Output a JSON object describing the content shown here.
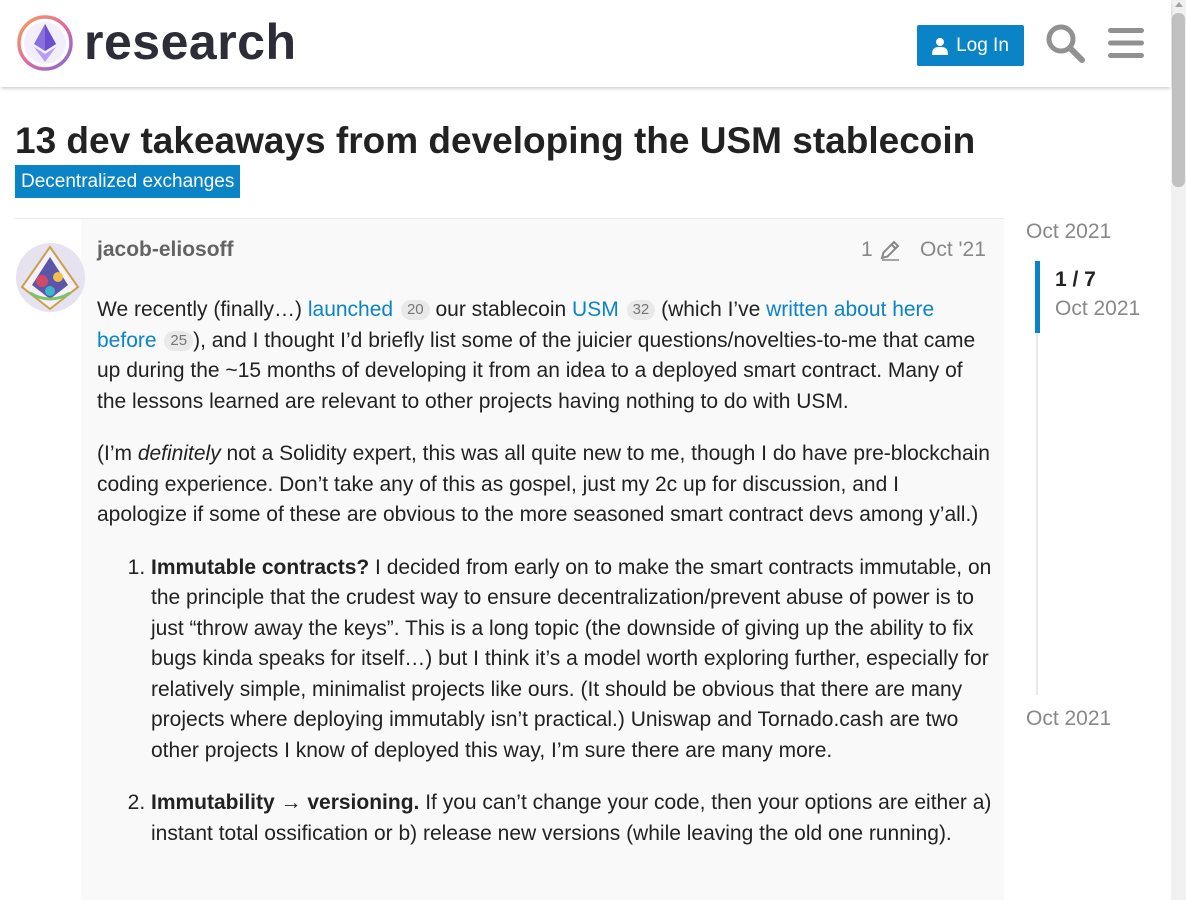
{
  "header": {
    "site_name": "research",
    "login_label": "Log In",
    "brand_color": "#0a84c7"
  },
  "topic": {
    "title": "13 dev takeaways from developing the USM stablecoin",
    "category": "Decentralized exchanges"
  },
  "post": {
    "username": "jacob-eliosoff",
    "edit_count": "1",
    "date": "Oct '21",
    "p1": {
      "t1": "We recently (finally…) ",
      "link1": "launched",
      "clicks1": "20",
      "t2": " our stablecoin ",
      "link2": "USM",
      "clicks2": "32",
      "t3": " (which I’ve ",
      "link3": "written about here before",
      "clicks3": "25",
      "t4": "), and I thought I’d briefly list some of the juicier questions/novelties-to-me that came up during the ~15 months of developing it from an idea to a deployed smart contract. Many of the lessons learned are relevant to other projects having nothing to do with USM."
    },
    "p2": {
      "t1": "(I’m ",
      "em": "definitely",
      "t2": " not a Solidity expert, this was all quite new to me, though I do have pre-blockchain coding experience. Don’t take any of this as gospel, just my 2c up for discussion, and I apologize if some of these are obvious to the more seasoned smart contract devs among y’all.)"
    },
    "list": [
      {
        "heading": "Immutable contracts?",
        "text": " I decided from early on to make the smart contracts immutable, on the principle that the crudest way to ensure decentralization/prevent abuse of power is to just “throw away the keys”. This is a long topic (the downside of giving up the ability to fix bugs kinda speaks for itself…) but I think it’s a model worth exploring further, especially for relatively simple, minimalist projects like ours. (It should be obvious that there are many projects where deploying immutably isn’t practical.) Uniswap and Tornado.cash are two other projects I know of deployed this way, I’m sure there are many more."
      },
      {
        "heading": "Immutability → versioning.",
        "text": " If you can’t change your code, then your options are either a) instant total ossification or b) release new versions (while leaving the old one running)."
      }
    ]
  },
  "timeline": {
    "start_date": "Oct 2021",
    "progress": "1 / 7",
    "handle_date": "Oct 2021",
    "end_date": "Oct 2021"
  }
}
